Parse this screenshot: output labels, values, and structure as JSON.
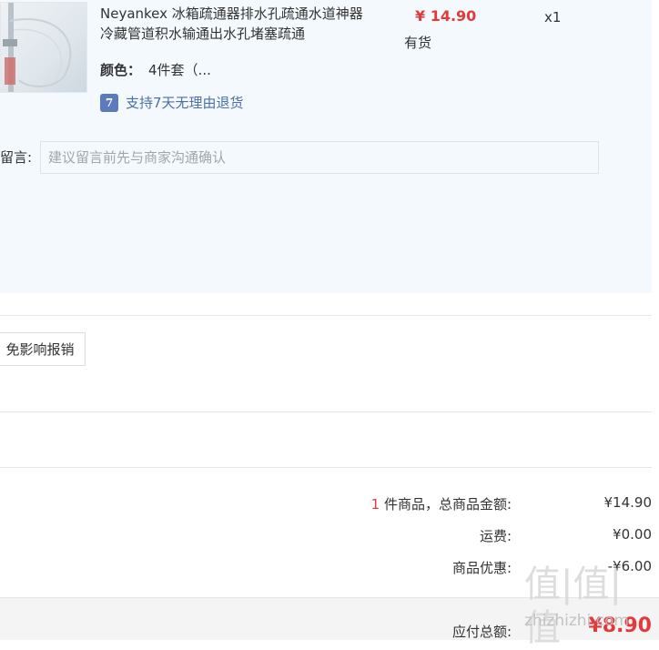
{
  "product": {
    "title": "Neyankex 冰箱疏通器排水孔疏通水道神器冷藏管道积水输通出水孔堵塞疏通",
    "color_label": "颜色：",
    "color_value": "4件套（...",
    "return_icon": "7",
    "return_policy": "支持7天无理由退货",
    "price": "¥ 14.90",
    "stock": "有货",
    "quantity": "x1"
  },
  "note": {
    "label": "留言:",
    "placeholder": "建议留言前先与商家沟通确认"
  },
  "invoice": {
    "button_label": "免影响报销"
  },
  "summary": {
    "count": "1",
    "items_label": " 件商品，总商品金额:",
    "items_total": "¥14.90",
    "shipping_label": "运费:",
    "shipping_value": "¥0.00",
    "discount_label": "商品优惠:",
    "discount_value": "-¥6.00",
    "payable_label": "应付总额:",
    "payable_value": "¥8.90"
  },
  "watermark": {
    "logo_text": "值|值|值",
    "url": "zhizhizhi.com"
  },
  "colors": {
    "price_red": "#e4393c",
    "panel_bg": "#f3f9fd",
    "link_blue": "#4b6fa6"
  }
}
